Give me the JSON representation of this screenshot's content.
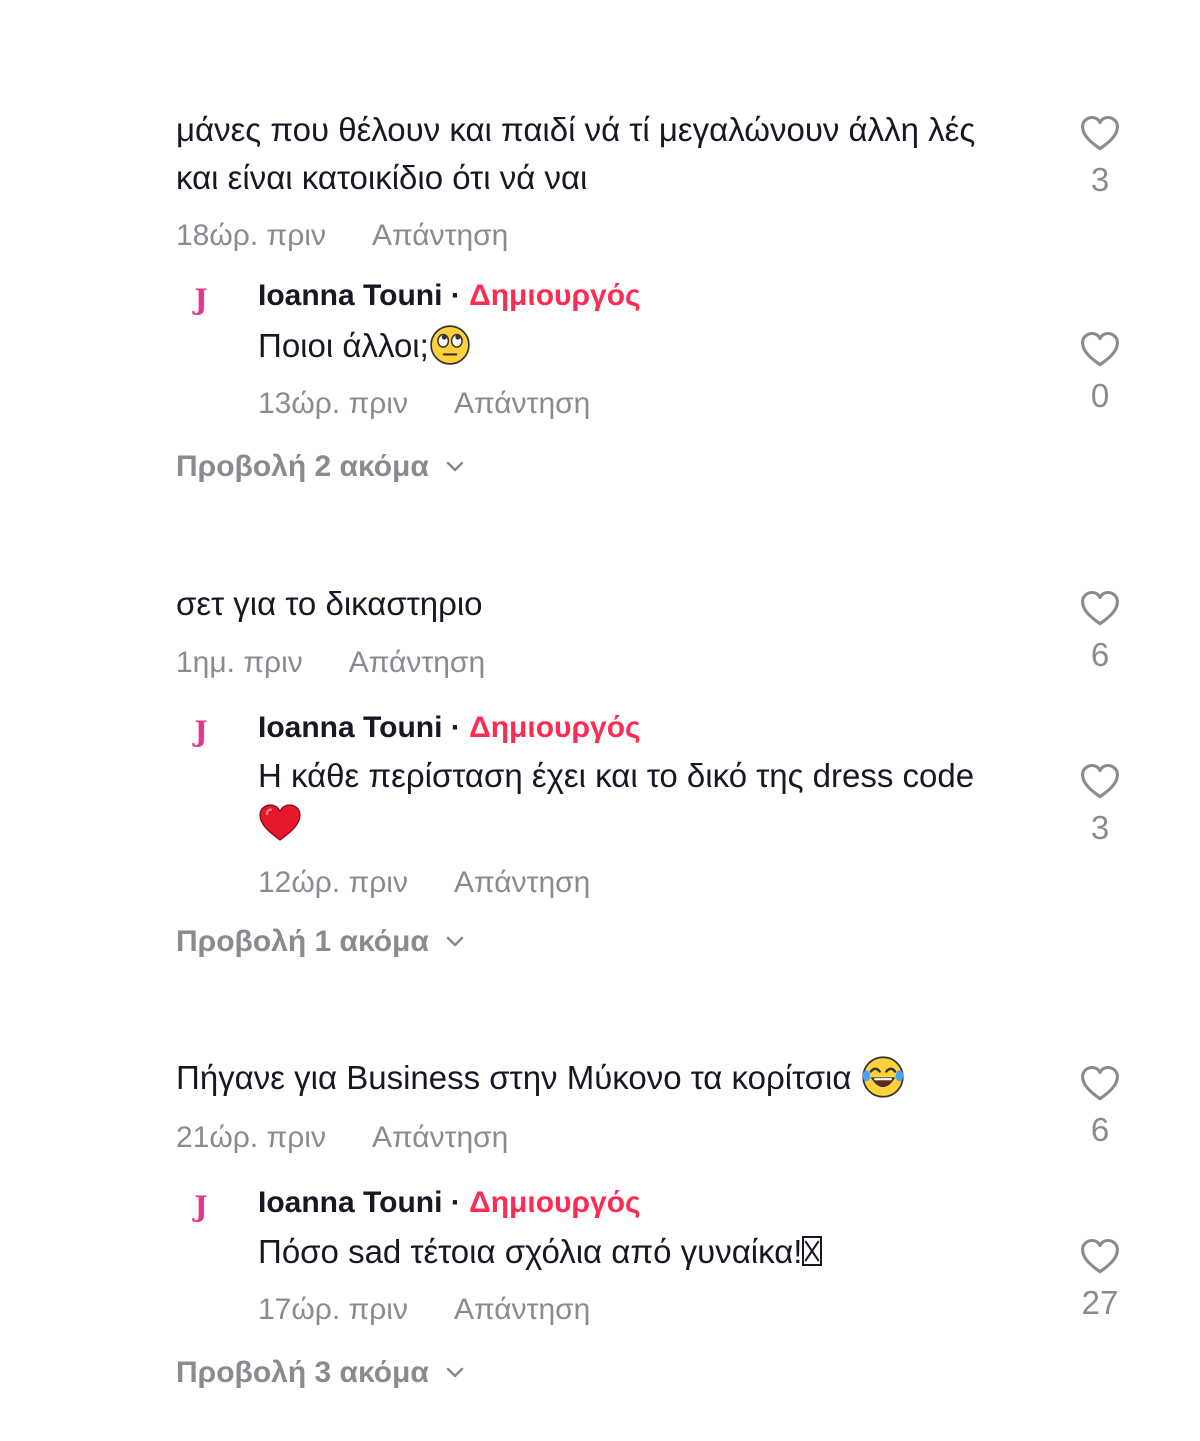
{
  "threads": [
    {
      "comment": {
        "text": "μάνες που θέλουν και παιδί νά τί μεγαλώνουν άλλη λές και είναι κατοικίδιο ότι νά ναι",
        "time": "18ώρ. πριν",
        "reply_label": "Απάντηση",
        "likes": "3"
      },
      "reply": {
        "avatar_letter": "J",
        "author": "Ioanna Touni",
        "separator": "·",
        "role": "Δημιουργός",
        "text": "Ποιοι άλλοι;",
        "emoji": "face-with-rolling-eyes-emoji",
        "time": "13ώρ. πριν",
        "reply_label": "Απάντηση",
        "likes": "0"
      },
      "view_more": "Προβολή 2 ακόμα"
    },
    {
      "comment": {
        "text": "σετ για το δικαστηριο",
        "time": "1ημ. πριν",
        "reply_label": "Απάντηση",
        "likes": "6"
      },
      "reply": {
        "avatar_letter": "J",
        "author": "Ioanna Touni",
        "separator": "·",
        "role": "Δημιουργός",
        "text": "Η κάθε περίσταση έχει και το δικό της dress code",
        "emoji": "red-heart-emoji",
        "time": "12ώρ. πριν",
        "reply_label": "Απάντηση",
        "likes": "3"
      },
      "view_more": "Προβολή 1 ακόμα"
    },
    {
      "comment": {
        "text": "Πήγανε για Business στην Μύκονο τα κορίτσια",
        "emoji": "face-with-tears-of-joy-emoji",
        "time": "21ώρ. πριν",
        "reply_label": "Απάντηση",
        "likes": "6"
      },
      "reply": {
        "avatar_letter": "J",
        "author": "Ioanna Touni",
        "separator": "·",
        "role": "Δημιουργός",
        "text": "Πόσο sad τέτοια σχόλια από γυναίκα!",
        "emoji": "missing-glyph-box",
        "time": "17ώρ. πριν",
        "reply_label": "Απάντηση",
        "likes": "27"
      },
      "view_more": "Προβολή 3 ακόμα"
    }
  ],
  "colors": {
    "text": "#161823",
    "muted": "#8a8b91",
    "creator": "#fe2c55",
    "avatar": "#e8348c"
  }
}
